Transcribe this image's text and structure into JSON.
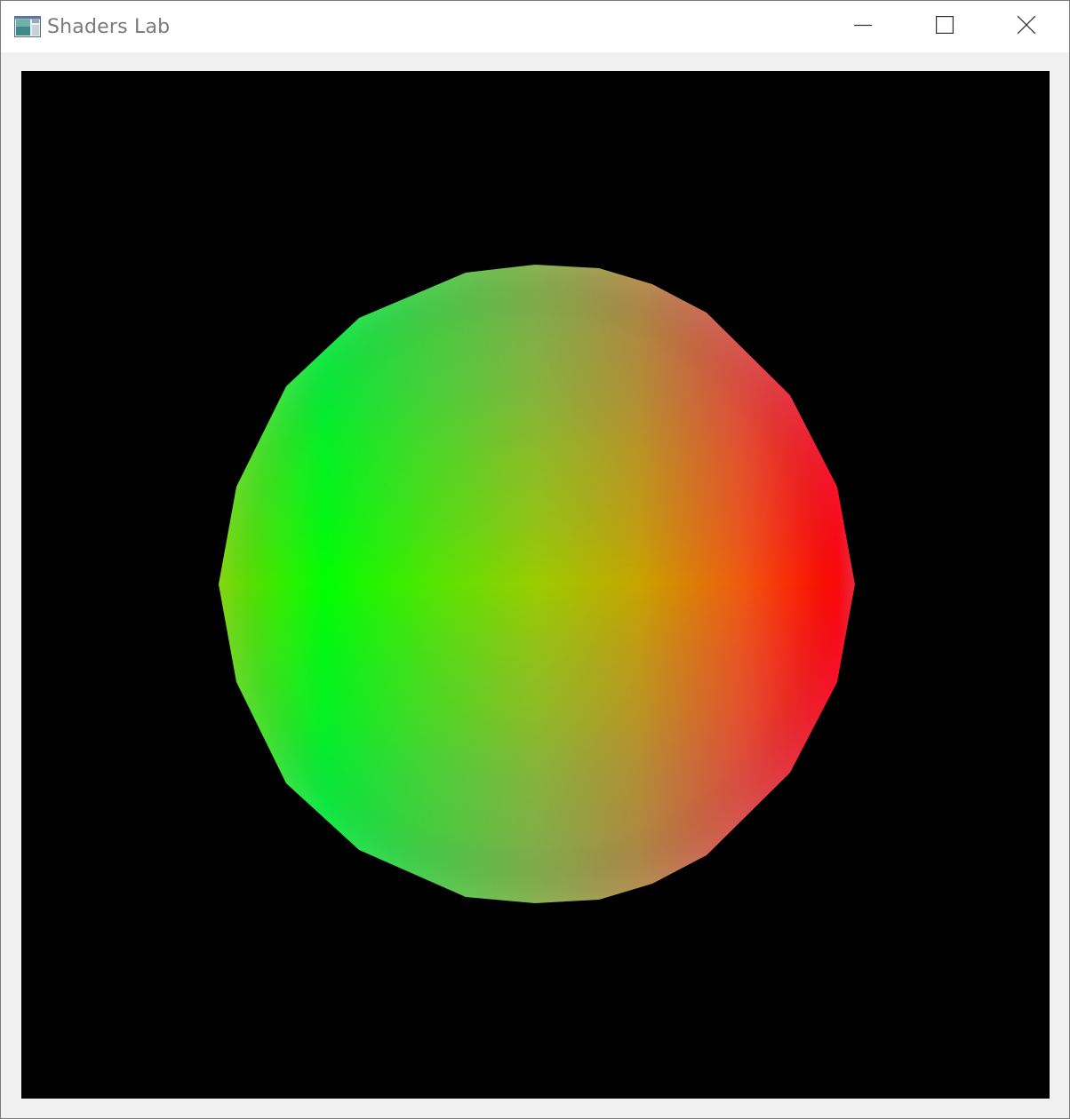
{
  "window": {
    "title": "Shaders Lab",
    "app_icon": "app-window-icon",
    "controls": {
      "minimize_icon": "minimize-icon",
      "maximize_icon": "maximize-icon",
      "close_icon": "close-icon"
    }
  },
  "viewport": {
    "background_color": "#000000",
    "object": "shaded-sphere",
    "colors": {
      "left": "#00ff00",
      "right": "#ff0000",
      "top": "#0000ff",
      "bottom": "#0000ff"
    }
  }
}
